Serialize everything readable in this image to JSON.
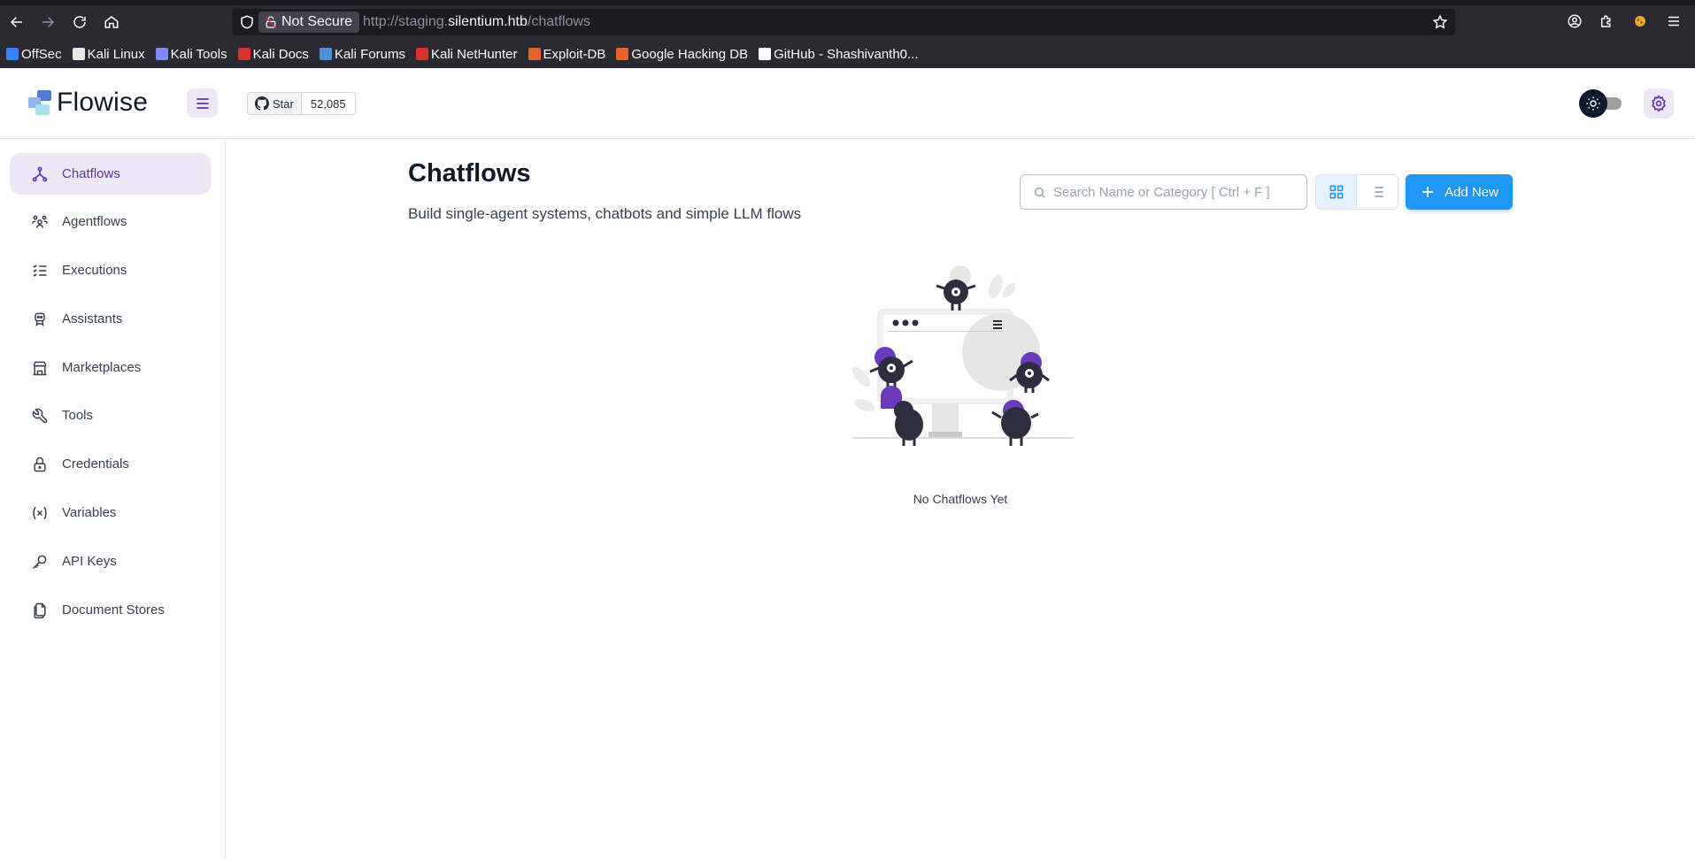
{
  "browser": {
    "not_secure_label": "Not Secure",
    "url_scheme": "http://staging.",
    "url_host": "silentium.htb",
    "url_path": "/chatflows",
    "bookmarks": [
      {
        "label": "OffSec",
        "color": "#3b82f6"
      },
      {
        "label": "Kali Linux",
        "color": "#e8e8e8"
      },
      {
        "label": "Kali Tools",
        "color": "#7c8cf8"
      },
      {
        "label": "Kali Docs",
        "color": "#d9342b"
      },
      {
        "label": "Kali Forums",
        "color": "#4a90d9"
      },
      {
        "label": "Kali NetHunter",
        "color": "#d9342b"
      },
      {
        "label": "Exploit-DB",
        "color": "#e8632b"
      },
      {
        "label": "Google Hacking DB",
        "color": "#e8632b"
      },
      {
        "label": "GitHub - Shashivanth0...",
        "color": "#ffffff"
      }
    ]
  },
  "header": {
    "logo_text": "Flowise",
    "github_star_label": "Star",
    "github_star_count": "52,085"
  },
  "sidebar": {
    "items": [
      {
        "label": "Chatflows",
        "icon": "hierarchy-icon",
        "active": true
      },
      {
        "label": "Agentflows",
        "icon": "users-group-icon",
        "active": false
      },
      {
        "label": "Executions",
        "icon": "list-check-icon",
        "active": false
      },
      {
        "label": "Assistants",
        "icon": "robot-icon",
        "active": false
      },
      {
        "label": "Marketplaces",
        "icon": "store-icon",
        "active": false
      },
      {
        "label": "Tools",
        "icon": "tool-icon",
        "active": false
      },
      {
        "label": "Credentials",
        "icon": "lock-icon",
        "active": false
      },
      {
        "label": "Variables",
        "icon": "variable-icon",
        "active": false
      },
      {
        "label": "API Keys",
        "icon": "key-icon",
        "active": false
      },
      {
        "label": "Document Stores",
        "icon": "files-icon",
        "active": false
      }
    ]
  },
  "main": {
    "title": "Chatflows",
    "subtitle": "Build single-agent systems, chatbots and simple LLM flows",
    "search_placeholder": "Search Name or Category [ Ctrl + F ]",
    "search_value": "",
    "add_new_label": "Add New",
    "view_mode": "card",
    "empty_message": "No Chatflows Yet"
  },
  "colors": {
    "accent_purple": "#5e35b1",
    "accent_purple_light": "#ede7f6",
    "primary_blue": "#2196f3"
  }
}
